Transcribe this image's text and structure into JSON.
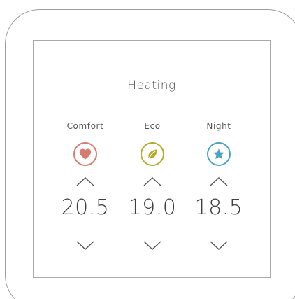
{
  "header": {
    "title": "Heating"
  },
  "modes": [
    {
      "label": "Comfort",
      "value": "20.5",
      "icon": "heart-icon",
      "color": "#d87a72"
    },
    {
      "label": "Eco",
      "value": "19.0",
      "icon": "leaf-icon",
      "color": "#b2ac27"
    },
    {
      "label": "Night",
      "value": "18.5",
      "icon": "star-icon",
      "color": "#4aa3c4"
    }
  ],
  "colors": {
    "frame": "#9c9c9c",
    "screen_border": "#a8a8a8",
    "text": "#4a4a4a",
    "arrow": "#555555"
  }
}
